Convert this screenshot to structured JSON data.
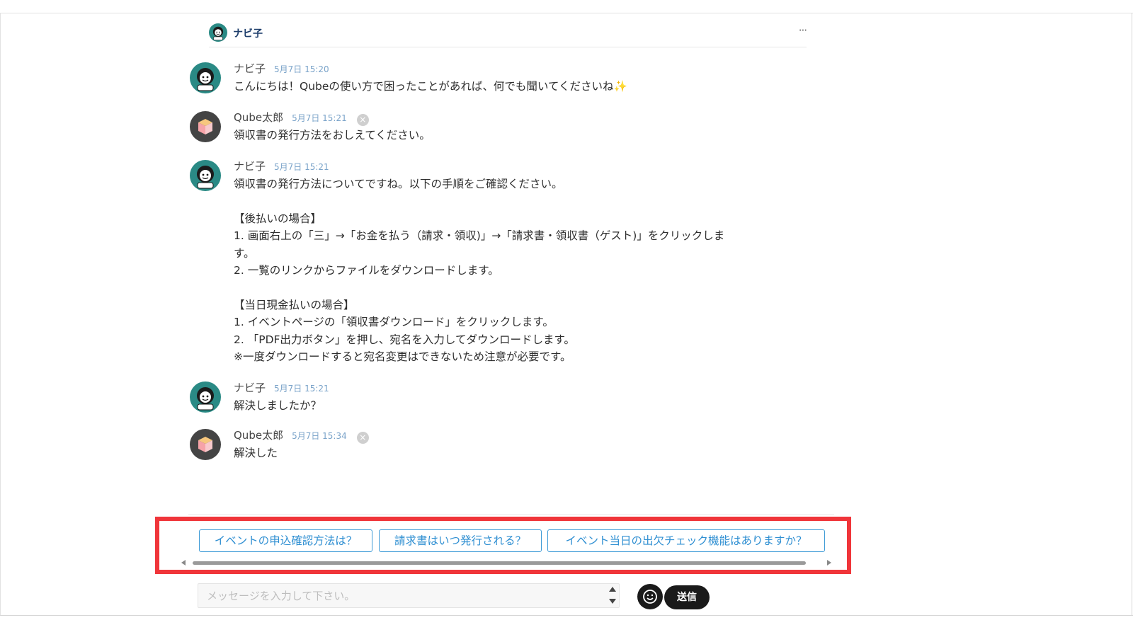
{
  "header": {
    "name": "ナビ子",
    "more": "···"
  },
  "messages": [
    {
      "sender": "ナビ子",
      "time": "5月7日 15:20",
      "text": "こんにちは！Qubeの使い方で困ったことがあれば、何でも聞いてくださいね",
      "sparkle": "✨",
      "avatar": "navi-avatar"
    },
    {
      "sender": "Qube太郎",
      "time": "5月7日 15:21",
      "text": "領収書の発行方法をおしえてください。",
      "avatar": "cube-avatar",
      "delete": "×"
    },
    {
      "sender": "ナビ子",
      "time": "5月7日 15:21",
      "text": "領収書の発行方法についてですね。以下の手順をご確認ください。\n\n【後払いの場合】\n1. 画面右上の「三」→「お金を払う（請求・領収)」→「請求書・領収書（ゲスト)」をクリックしま\nす。\n2. 一覧のリンクからファイルをダウンロードします。\n\n【当日現金払いの場合】\n1. イベントページの「領収書ダウンロード」をクリックします。\n2. 「PDF出力ボタン」を押し、宛名を入力してダウンロードします。\n※一度ダウンロードすると宛名変更はできないため注意が必要です。",
      "avatar": "navi-avatar"
    },
    {
      "sender": "ナビ子",
      "time": "5月7日 15:21",
      "text": "解決しましたか？",
      "avatar": "navi-avatar"
    },
    {
      "sender": "Qube太郎",
      "time": "5月7日 15:34",
      "text": "解決した",
      "avatar": "cube-avatar",
      "delete": "×"
    }
  ],
  "suggestions": [
    "イベントの申込確認方法は？",
    "請求書はいつ発行される？",
    "イベント当日の出欠チェック機能はありますか？"
  ],
  "input": {
    "placeholder": "メッセージを入力して下さい。",
    "value": ""
  },
  "send_label": "送信",
  "colors": {
    "highlight": "#f0353a",
    "accent": "#2f8fd2",
    "time": "#7aa3c9",
    "avatar_teal": "#2a8a85",
    "avatar_dark": "#444444"
  }
}
